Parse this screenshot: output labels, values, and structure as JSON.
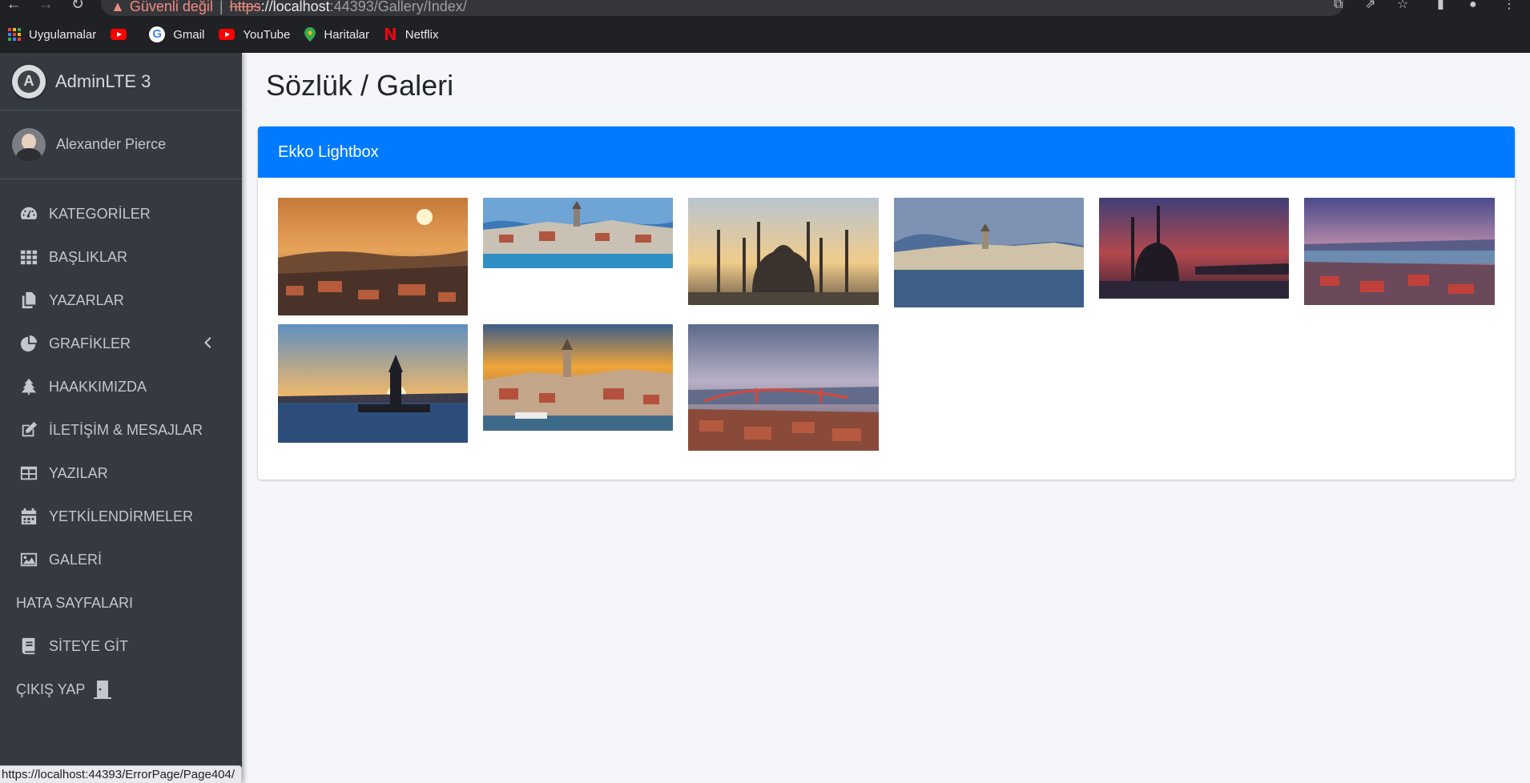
{
  "browser": {
    "security_text": "Güvenli değil",
    "url_protocol": "https",
    "url_host": "://localhost",
    "url_rest": ":44393/Gallery/Index/",
    "bookmarks": [
      {
        "label": "Uygulamalar",
        "icon": "apps-grid-icon"
      },
      {
        "label": "",
        "icon": "youtube-icon"
      },
      {
        "label": "Gmail",
        "icon": "google-icon"
      },
      {
        "label": "YouTube",
        "icon": "youtube-icon"
      },
      {
        "label": "Haritalar",
        "icon": "maps-icon"
      },
      {
        "label": "Netflix",
        "icon": "netflix-icon"
      }
    ],
    "status_url": "https://localhost:44393/ErrorPage/Page404/"
  },
  "sidebar": {
    "brand": "AdminLTE 3",
    "user": "Alexander Pierce",
    "items": [
      {
        "label": "KATEGORİLER",
        "icon": "tachometer-icon"
      },
      {
        "label": "BAŞLIKLAR",
        "icon": "th-grid-icon"
      },
      {
        "label": "YAZARLAR",
        "icon": "copy-icon"
      },
      {
        "label": "GRAFİKLER",
        "icon": "chart-pie-icon"
      },
      {
        "label": "HAAKKIMIZDA",
        "icon": "tree-icon"
      },
      {
        "label": "İLETİŞİM & MESAJLAR",
        "icon": "edit-icon"
      },
      {
        "label": "YAZILAR",
        "icon": "columns-icon"
      },
      {
        "label": "YETKİLENDİRMELER",
        "icon": "calendar-icon"
      },
      {
        "label": "GALERİ",
        "icon": "image-icon"
      },
      {
        "label": "HATA SAYFALARI",
        "icon": ""
      },
      {
        "label": "SİTEYE GİT",
        "icon": "book-icon"
      },
      {
        "label": "ÇIKIŞ YAP",
        "icon": "door-icon"
      }
    ]
  },
  "main": {
    "title": "Sözlük / Galeri",
    "card_title": "Ekko Lightbox"
  },
  "colors": {
    "sidebar_bg": "#343a40",
    "primary": "#007bff",
    "content_bg": "#f4f6f9"
  }
}
